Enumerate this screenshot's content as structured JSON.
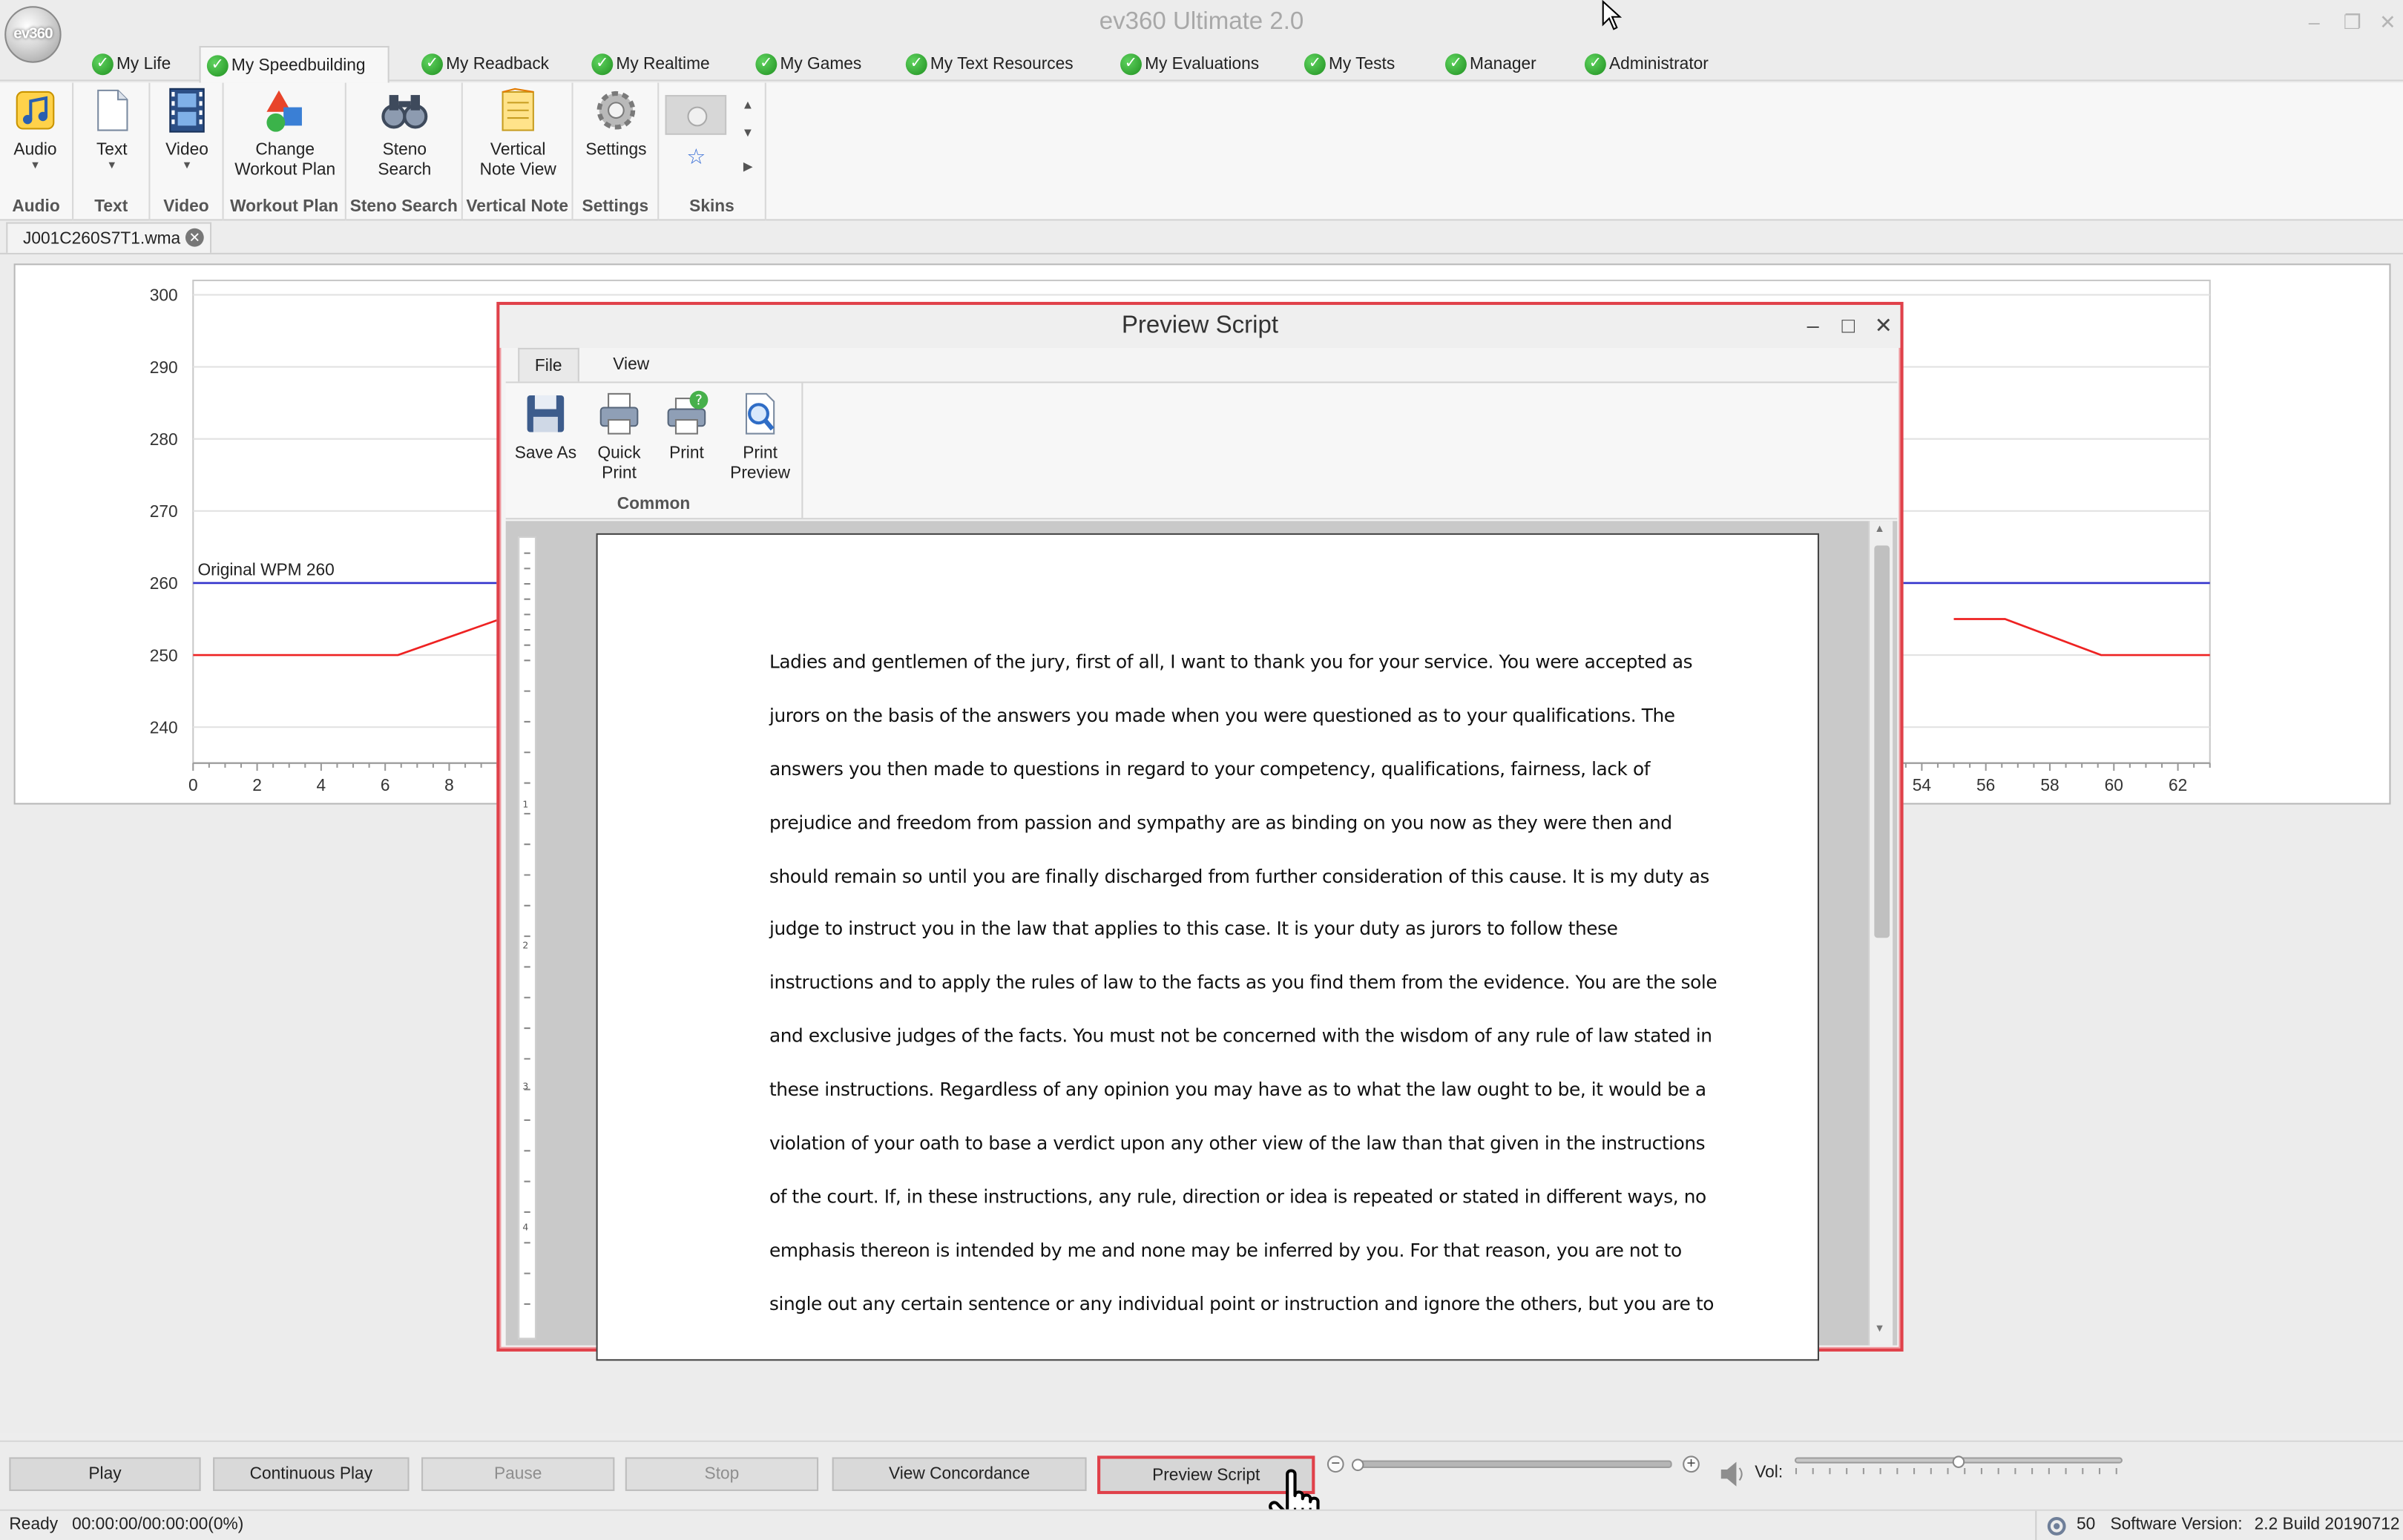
{
  "window": {
    "title": "ev360 Ultimate 2.0",
    "logo_text": "ev360"
  },
  "tabs": [
    {
      "label": "My Life"
    },
    {
      "label": "My Speedbuilding"
    },
    {
      "label": "My Readback"
    },
    {
      "label": "My Realtime"
    },
    {
      "label": "My Games"
    },
    {
      "label": "My Text Resources"
    },
    {
      "label": "My Evaluations"
    },
    {
      "label": "My Tests"
    },
    {
      "label": "Manager"
    },
    {
      "label": "Administrator"
    }
  ],
  "ribbon": {
    "audio": {
      "button": "Audio",
      "group": "Audio"
    },
    "text": {
      "button": "Text",
      "group": "Text"
    },
    "video": {
      "button": "Video",
      "group": "Video"
    },
    "workout": {
      "button_line1": "Change",
      "button_line2": "Workout Plan",
      "group": "Workout Plan"
    },
    "steno": {
      "button_line1": "Steno",
      "button_line2": "Search",
      "group": "Steno Search"
    },
    "vertical": {
      "button_line1": "Vertical",
      "button_line2": "Note View",
      "group": "Vertical Note"
    },
    "settings": {
      "button": "Settings",
      "group": "Settings"
    },
    "skins": {
      "group": "Skins"
    }
  },
  "document_tab": {
    "label": "J001C260S7T1.wma"
  },
  "chart_data": {
    "type": "line",
    "title": "",
    "xlabel": "",
    "ylabel": "",
    "xlim": [
      0,
      63
    ],
    "ylim": [
      235,
      302
    ],
    "x_ticks_visible": [
      0,
      2,
      4,
      6,
      8,
      54,
      56,
      58,
      60,
      62
    ],
    "y_ticks": [
      240,
      250,
      260,
      270,
      280,
      290,
      300
    ],
    "grid": "horizontal",
    "annotation": "Original WPM 260",
    "series": [
      {
        "name": "",
        "color": "#3333cc",
        "x": [
          0,
          63
        ],
        "y": [
          260,
          260
        ]
      },
      {
        "name": "",
        "color": "#ee2222",
        "x": [
          0,
          6.4,
          9.6
        ],
        "y": [
          250,
          250,
          255
        ]
      },
      {
        "name": "",
        "color": "#ee2222",
        "x": [
          55,
          56.6,
          59.6,
          63
        ],
        "y": [
          255,
          255,
          250,
          250
        ]
      }
    ]
  },
  "dialog": {
    "title": "Preview Script",
    "tabs": {
      "file": "File",
      "view": "View"
    },
    "buttons": {
      "save_as": "Save As",
      "quick_print_1": "Quick",
      "quick_print_2": "Print",
      "print": "Print",
      "print_preview_1": "Print",
      "print_preview_2": "Preview"
    },
    "group_label": "Common",
    "script_lines": [
      "Ladies and gentlemen of the jury, first of all, I want to thank you for your service.  You were accepted as",
      "jurors on the basis of the answers you made when you were questioned as to your qualifications.  The",
      "answers you then made to questions in regard to your competency, qualifications, fairness, lack of",
      "prejudice and freedom from passion and sympathy are as binding on you now as they were then and",
      "should remain so until you are finally discharged from further consideration of this cause.  It is my duty as",
      "judge to instruct you in the law that applies to this case. It is your duty as jurors to follow these",
      "instructions and to apply the rules of law to the facts as you find them from the evidence. You are the sole",
      "and exclusive judges of the facts.  You must not be concerned with the wisdom of any rule of law stated in",
      "these instructions. Regardless of any opinion you may have as to what the law ought to be, it would be a",
      "violation of your oath to base a verdict upon any other view of the law than that given in the instructions",
      "of the court. If, in these instructions, any rule, direction or idea is repeated or stated in different ways, no",
      "emphasis thereon is intended by me and none may be inferred by you.   For that reason, you are not to",
      "single out any certain sentence or any individual point or instruction and ignore the others, but you are to"
    ],
    "ruler_marks": [
      "1",
      "2",
      "3",
      "4"
    ]
  },
  "bottom_bar": {
    "play": "Play",
    "continuous_play": "Continuous Play",
    "pause": "Pause",
    "stop": "Stop",
    "view_concordance": "View Concordance",
    "preview_script": "Preview  Script",
    "vol_label": "Vol:",
    "volume_level": 0.5
  },
  "status_bar": {
    "ready": "Ready",
    "time": "00:00:00/00:00:00(0%)",
    "count": "50",
    "software_version_label": "Software Version:",
    "software_version": "2.2 Build 20190712"
  }
}
